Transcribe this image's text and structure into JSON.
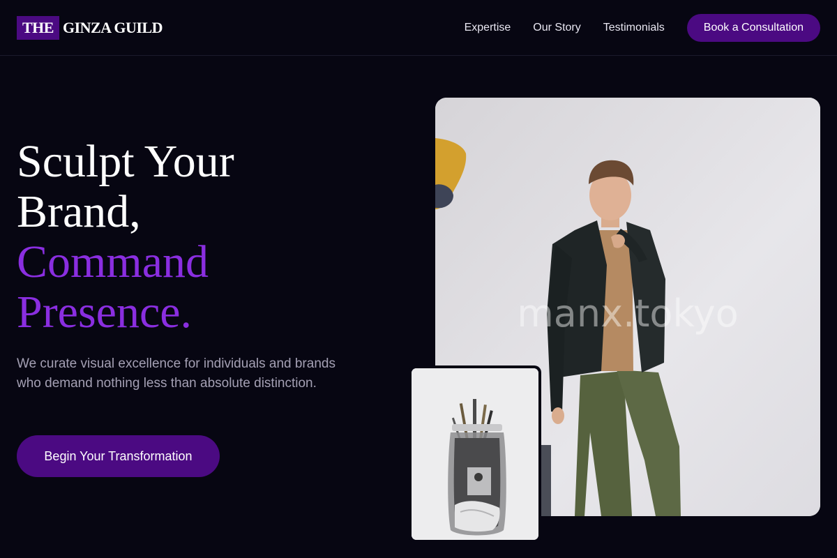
{
  "brand": {
    "mark": "THE",
    "name": "GINZA GUILD"
  },
  "nav": {
    "items": [
      "Expertise",
      "Our Story",
      "Testimonials"
    ],
    "cta_label": "Book a Consultation"
  },
  "hero": {
    "title_lines": [
      "Sculpt Your",
      "Brand,"
    ],
    "title_accent_lines": [
      "Command",
      "Presence."
    ],
    "subtitle": "We curate visual excellence for individuals and brands who demand nothing less than absolute distinction.",
    "cta_label": "Begin Your Transformation"
  },
  "media": {
    "main_photo": "man-in-blazer-photo",
    "secondary_photo": "brush-jar-photo",
    "watermark": "manx.tokyo"
  },
  "colors": {
    "background": "#070612",
    "accent": "#4b0a82",
    "accent_text": "#8a2ee0",
    "muted_text": "#a4a0b4"
  }
}
